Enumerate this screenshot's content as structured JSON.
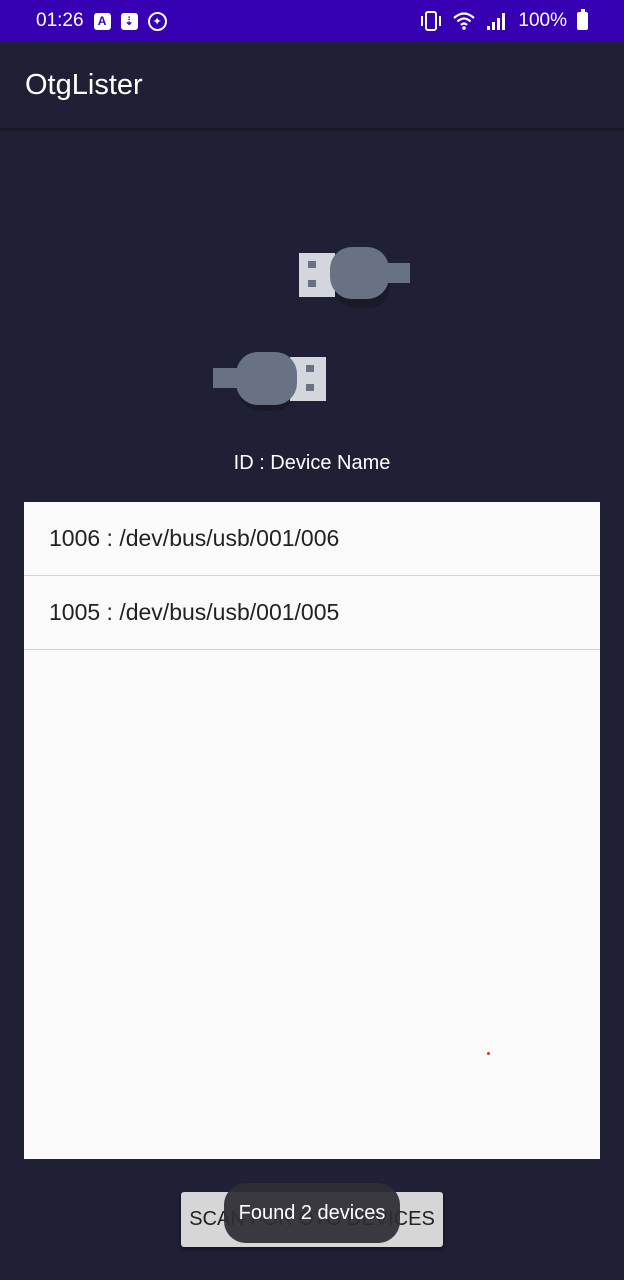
{
  "status_bar": {
    "time": "01:26",
    "notification_icons": [
      "a-icon",
      "usb-icon",
      "accessibility-icon"
    ],
    "battery": "100%",
    "system_icons": [
      "vibrate-icon",
      "wifi-icon",
      "signal-icon",
      "battery-charging-icon"
    ]
  },
  "toolbar": {
    "title": "OtgLister"
  },
  "illustration": {
    "icon": "usb-plugs-icon"
  },
  "list_header": "ID : Device Name",
  "devices": [
    {
      "label": "1006 : /dev/bus/usb/001/006"
    },
    {
      "label": "1005 : /dev/bus/usb/001/005"
    }
  ],
  "scan_button": {
    "label": "SCAN FOR OTG DEVICES"
  },
  "toast": {
    "message": "Found 2 devices"
  },
  "colors": {
    "status_bar": "#3700b3",
    "background": "#1f1f35",
    "list_background": "#fafafa",
    "usb_gray": "#687284",
    "usb_light": "#d3d6dc"
  }
}
